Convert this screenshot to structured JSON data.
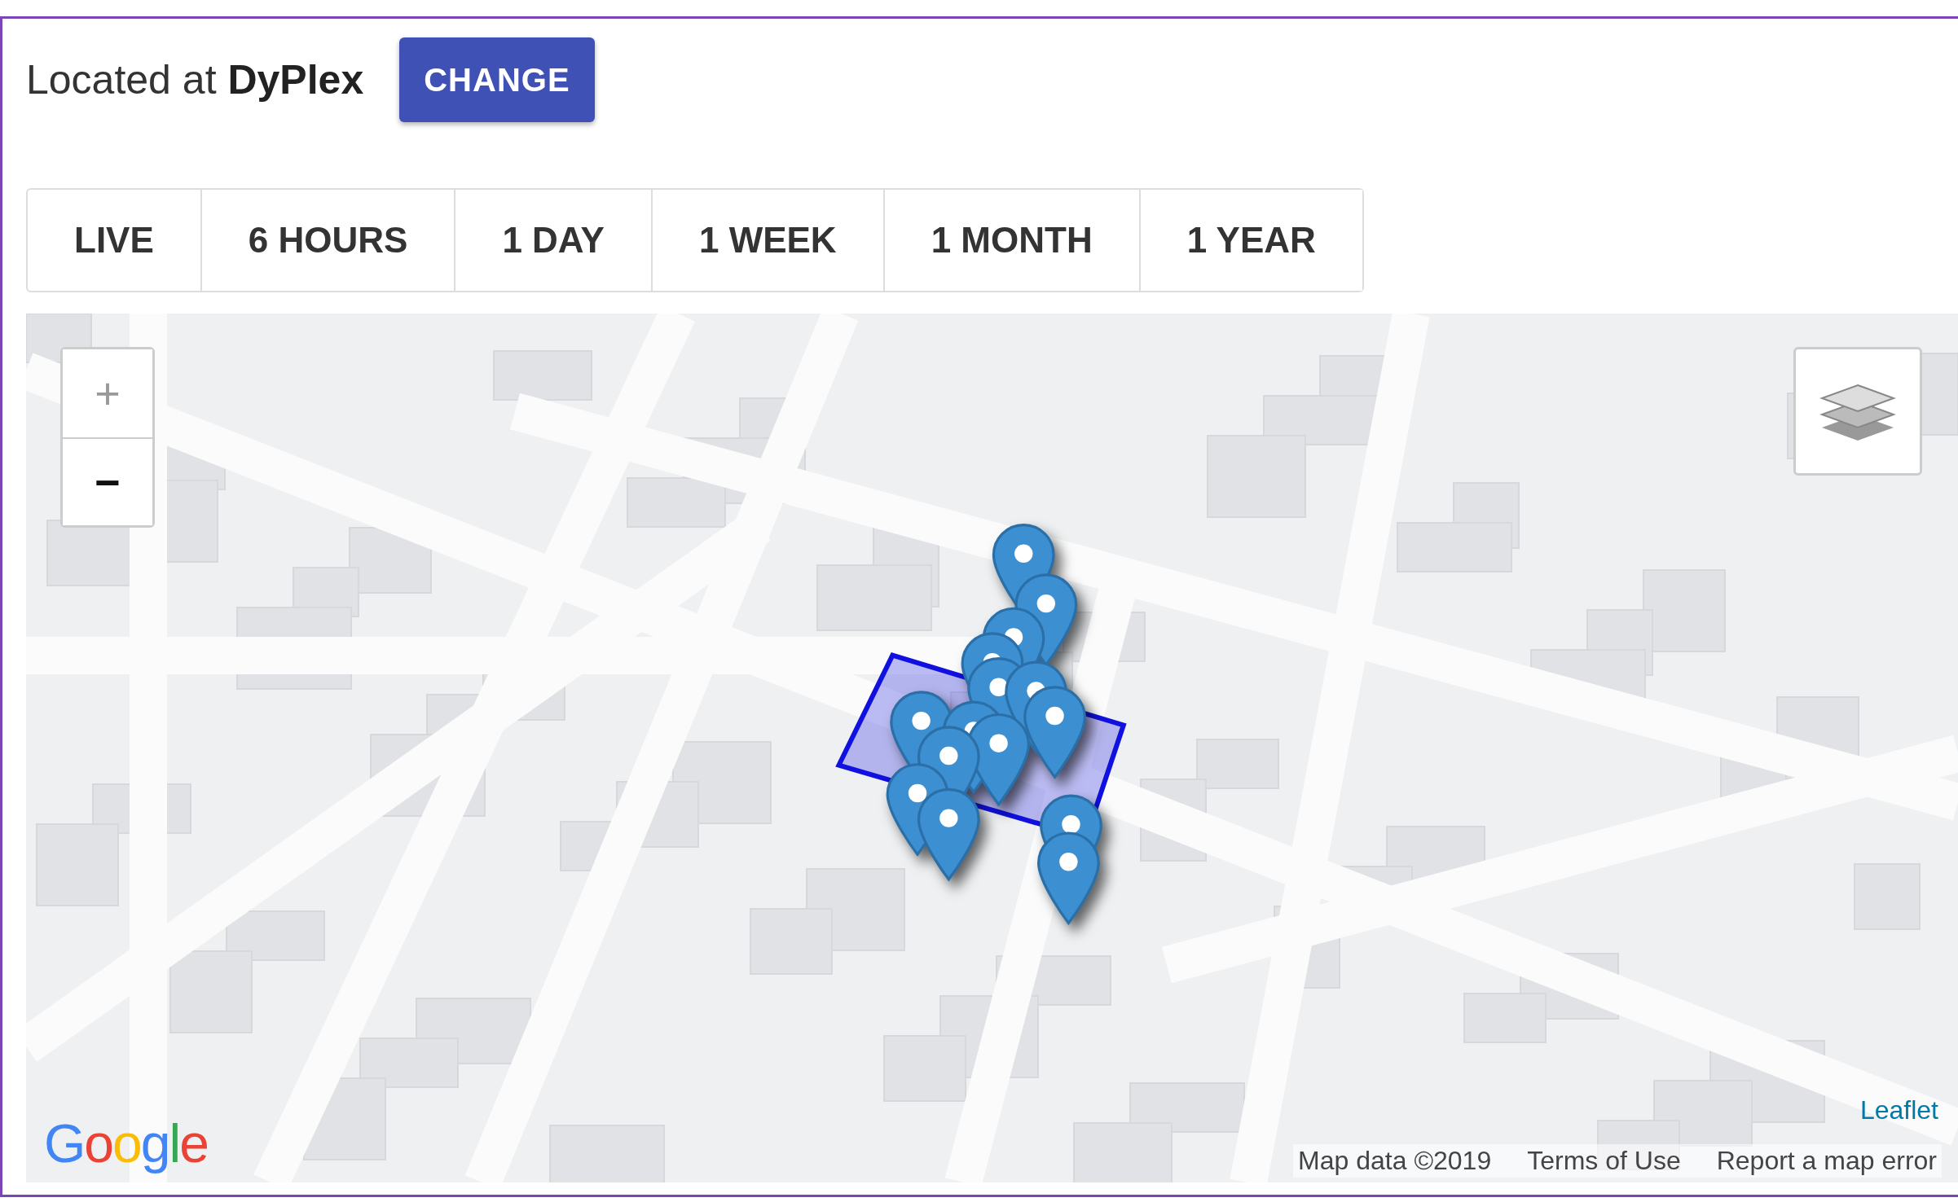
{
  "location": {
    "prefix": "Located at",
    "name": "DyPlex"
  },
  "change_button": "CHANGE",
  "range_tabs": [
    {
      "label": "LIVE",
      "selected": false
    },
    {
      "label": "6 HOURS",
      "selected": false
    },
    {
      "label": "1 DAY",
      "selected": false
    },
    {
      "label": "1 WEEK",
      "selected": false
    },
    {
      "label": "1 MONTH",
      "selected": false
    },
    {
      "label": "1 YEAR",
      "selected": false
    }
  ],
  "map": {
    "zoom_in": "+",
    "zoom_out": "−",
    "logo": "Google",
    "attribution": {
      "leaflet": "Leaflet",
      "map_data": "Map data ©2019",
      "terms": "Terms of Use",
      "report": "Report a map error"
    }
  }
}
